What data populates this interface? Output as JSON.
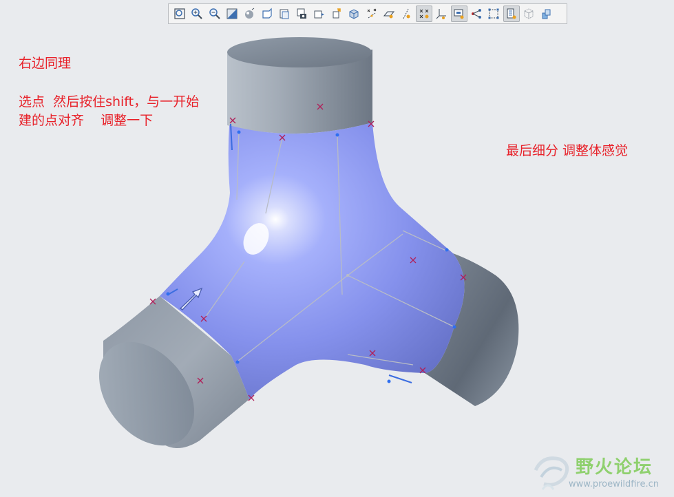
{
  "toolbar": {
    "buttons": [
      {
        "icon": "refit-icon",
        "active": false
      },
      {
        "icon": "zoom-in-icon",
        "active": false
      },
      {
        "icon": "zoom-out-icon",
        "active": false
      },
      {
        "icon": "repaint-icon",
        "active": false
      },
      {
        "icon": "shading-icon",
        "active": false
      },
      {
        "icon": "saved-views-icon",
        "active": false
      },
      {
        "icon": "view-manager-icon",
        "active": false
      },
      {
        "icon": "camera-icon",
        "active": false
      },
      {
        "icon": "spin-center-icon",
        "active": false
      },
      {
        "icon": "annotation-display-icon",
        "active": false
      },
      {
        "icon": "view-normal-icon",
        "active": false
      },
      {
        "icon": "datum-points-icon",
        "active": false
      },
      {
        "icon": "datum-planes-icon",
        "active": false
      },
      {
        "icon": "datum-axes-icon",
        "active": false
      },
      {
        "icon": "point-tags-icon",
        "active": true
      },
      {
        "icon": "coordinate-system-icon",
        "active": false
      },
      {
        "icon": "display-style-icon",
        "active": true
      },
      {
        "icon": "curve-points-icon",
        "active": false
      },
      {
        "icon": "control-mesh-icon",
        "active": false
      },
      {
        "icon": "filter-display-icon",
        "active": true
      },
      {
        "icon": "hidden-line-icon",
        "active": false
      },
      {
        "icon": "model-tree-icon",
        "active": false
      }
    ]
  },
  "notes": {
    "left_title": "右边同理",
    "left_line1": "选点  然后按住shift，与一开始",
    "left_line2": "建的点对齐    调整一下",
    "right": "最后细分 调整体感觉"
  },
  "watermark": {
    "name": "野火论坛",
    "url": "www.proewildfire.cn"
  },
  "colors": {
    "background": "#e9ebee",
    "note_text": "#e8222a",
    "surface_blue": "#8d9af2",
    "cylinder_gray": "#8f9aa7",
    "point_marker": "#b0205a",
    "control_point": "#2f6ff0"
  }
}
